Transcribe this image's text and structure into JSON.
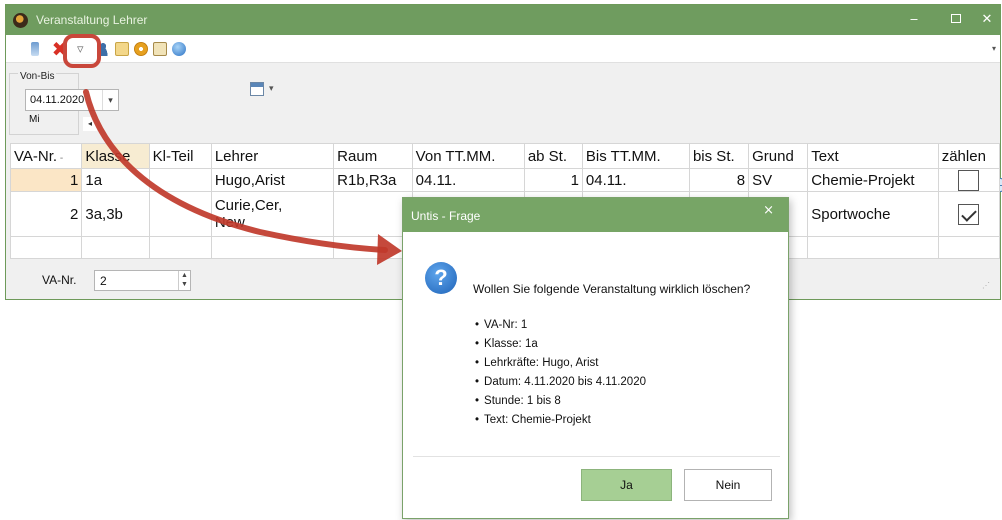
{
  "window": {
    "title": "Veranstaltung Lehrer",
    "minimize": "‒",
    "close": "✕"
  },
  "toolbar": {
    "icons": [
      "grid-icon",
      "insert-icon",
      "delete-icon",
      "filter-icon",
      "person-icon",
      "document-icon",
      "gear-icon",
      "book-icon",
      "globe-icon"
    ],
    "delete_glyph": "✖",
    "filter_glyph": "▿"
  },
  "filter": {
    "group_label": "Von-Bis",
    "date_value": "04.11.2020",
    "weekday": "Mi"
  },
  "grid": {
    "columns": [
      "VA-Nr.",
      "Klasse",
      "Kl-Teil",
      "Lehrer",
      "Raum",
      "Von TT.MM.",
      "ab St.",
      "Bis TT.MM.",
      "bis St.",
      "Grund",
      "Text",
      "zählen"
    ],
    "sort_indicator": "-",
    "rows": [
      {
        "va_nr": "1",
        "klasse": "1a",
        "kl_teil": "",
        "lehrer": "Hugo,Arist",
        "raum": "R1b,R3a",
        "von": "04.11.",
        "ab_st": "1",
        "bis": "04.11.",
        "bis_st": "8",
        "grund": "SV",
        "text": "Chemie-Projekt",
        "zaehlen": false
      },
      {
        "va_nr": "2",
        "klasse": "3a,3b",
        "kl_teil": "",
        "lehrer_line1": "Curie,Cer,",
        "lehrer_line2": "New",
        "raum": "",
        "von": "",
        "ab_st": "",
        "bis": "",
        "bis_st": "",
        "grund": "",
        "text": "Sportwoche",
        "zaehlen": true
      }
    ]
  },
  "status": {
    "label": "VA-Nr.",
    "value": "2"
  },
  "dialog": {
    "title": "Untis - Frage",
    "close": "×",
    "icon": "?",
    "question": "Wollen Sie folgende Veranstaltung wirklich löschen?",
    "details": [
      "VA-Nr: 1",
      "Klasse: 1a",
      "Lehrkräfte: Hugo, Arist",
      "Datum:  4.11.2020 bis  4.11.2020",
      "Stunde: 1 bis 8",
      "Text: Chemie-Projekt"
    ],
    "yes_label": "Ja",
    "no_label": "Nein"
  },
  "colors": {
    "title_bar": "#6f9c5f",
    "dialog_title_bar": "#77a566",
    "highlight": "#c9473b",
    "yes_button": "#a6cf94"
  }
}
